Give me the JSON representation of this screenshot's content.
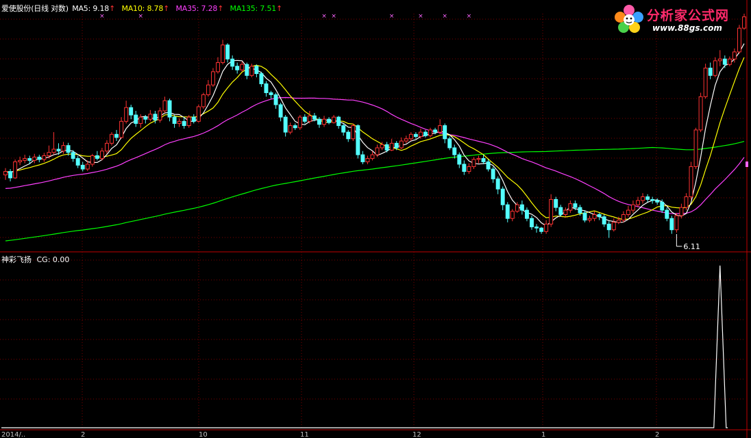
{
  "header": {
    "title": "爱使股份(日线 对数)",
    "ma5": "MA5: 9.18",
    "ma10": "MA10: 8.78",
    "ma35": "MA35: 7.28",
    "ma135": "MA135: 7.51",
    "up_arrow": "↑",
    "ma5_color": "#ffffff",
    "ma10_color": "#ffff00",
    "ma35_color": "#ff40ff",
    "ma135_color": "#00ff00"
  },
  "indicator": {
    "title": "神彩飞扬",
    "value": "CG: 0.00"
  },
  "logo": {
    "site_name": "分析家公式网",
    "url": "www.88gs.com"
  },
  "annotation": {
    "low_label": "6.11"
  },
  "x_axis_labels": [
    "2014/..",
    "2",
    "10",
    "11",
    "12",
    "1",
    "2"
  ],
  "colors": {
    "up": "#ff3333",
    "down": "#54ffff",
    "grid": "#800000",
    "axis": "#c00000"
  },
  "chart_data": [
    {
      "type": "candlestick",
      "title": "爱使股份(日线 对数)",
      "scale": "log",
      "ylim": [
        5.9,
        11.4
      ],
      "annotations": [
        {
          "index": 139,
          "text": "6.11"
        }
      ],
      "candles": [
        [
          7.28,
          7.35,
          7.42,
          7.18
        ],
        [
          7.35,
          7.22,
          7.4,
          7.15
        ],
        [
          7.22,
          7.55,
          7.6,
          7.2
        ],
        [
          7.55,
          7.58,
          7.66,
          7.48
        ],
        [
          7.58,
          7.62,
          7.7,
          7.52
        ],
        [
          7.62,
          7.58,
          7.68,
          7.5
        ],
        [
          7.58,
          7.65,
          7.72,
          7.52
        ],
        [
          7.65,
          7.6,
          7.7,
          7.54
        ],
        [
          7.6,
          7.68,
          7.74,
          7.55
        ],
        [
          7.68,
          7.75,
          7.9,
          7.62
        ],
        [
          7.75,
          7.82,
          8.2,
          7.7
        ],
        [
          7.82,
          7.78,
          7.95,
          7.7
        ],
        [
          7.78,
          7.9,
          7.98,
          7.72
        ],
        [
          7.9,
          7.75,
          7.96,
          7.68
        ],
        [
          7.75,
          7.62,
          7.8,
          7.55
        ],
        [
          7.62,
          7.48,
          7.68,
          7.42
        ],
        [
          7.48,
          7.4,
          7.55,
          7.35
        ],
        [
          7.4,
          7.5,
          7.58,
          7.36
        ],
        [
          7.5,
          7.68,
          7.72,
          7.45
        ],
        [
          7.68,
          7.62,
          7.78,
          7.58
        ],
        [
          7.62,
          7.78,
          7.85,
          7.58
        ],
        [
          7.78,
          7.95,
          8.02,
          7.72
        ],
        [
          7.95,
          8.15,
          8.2,
          7.9
        ],
        [
          8.15,
          8.08,
          8.25,
          8.0
        ],
        [
          8.08,
          8.45,
          8.55,
          8.05
        ],
        [
          8.45,
          8.78,
          8.95,
          8.4
        ],
        [
          8.78,
          8.6,
          8.85,
          8.5
        ],
        [
          8.6,
          8.4,
          8.7,
          8.32
        ],
        [
          8.4,
          8.55,
          8.62,
          8.3
        ],
        [
          8.55,
          8.5,
          8.6,
          8.4
        ],
        [
          8.5,
          8.62,
          8.72,
          8.45
        ],
        [
          8.62,
          8.48,
          8.7,
          8.4
        ],
        [
          8.48,
          8.7,
          8.78,
          8.42
        ],
        [
          8.7,
          8.95,
          9.05,
          8.65
        ],
        [
          8.95,
          8.55,
          9.0,
          8.45
        ],
        [
          8.55,
          8.4,
          8.6,
          8.3
        ],
        [
          8.4,
          8.45,
          8.52,
          8.32
        ],
        [
          8.45,
          8.35,
          8.55,
          8.28
        ],
        [
          8.35,
          8.55,
          8.6,
          8.3
        ],
        [
          8.55,
          8.45,
          8.62,
          8.4
        ],
        [
          8.45,
          8.8,
          8.85,
          8.42
        ],
        [
          8.8,
          9.1,
          9.15,
          8.75
        ],
        [
          9.1,
          9.35,
          9.48,
          9.05
        ],
        [
          9.35,
          9.7,
          9.8,
          9.3
        ],
        [
          9.7,
          9.95,
          10.1,
          9.65
        ],
        [
          9.95,
          10.45,
          10.6,
          9.9
        ],
        [
          10.45,
          10.05,
          10.5,
          9.95
        ],
        [
          10.05,
          9.85,
          10.15,
          9.75
        ],
        [
          9.85,
          9.75,
          9.95,
          9.65
        ],
        [
          9.75,
          9.9,
          9.98,
          9.7
        ],
        [
          9.9,
          9.6,
          9.95,
          9.5
        ],
        [
          9.6,
          9.85,
          9.92,
          9.55
        ],
        [
          9.85,
          9.65,
          9.9,
          9.55
        ],
        [
          9.65,
          9.38,
          9.7,
          9.3
        ],
        [
          9.38,
          9.15,
          9.45,
          9.05
        ],
        [
          9.15,
          9.1,
          9.2,
          9.0
        ],
        [
          9.1,
          8.85,
          9.15,
          8.75
        ],
        [
          8.85,
          8.55,
          8.9,
          8.45
        ],
        [
          8.55,
          8.2,
          8.6,
          8.1
        ],
        [
          8.2,
          8.35,
          8.42,
          8.15
        ],
        [
          8.35,
          8.3,
          8.4,
          8.25
        ],
        [
          8.3,
          8.55,
          8.6,
          8.25
        ],
        [
          8.55,
          8.45,
          8.62,
          8.4
        ],
        [
          8.45,
          8.58,
          8.7,
          8.4
        ],
        [
          8.58,
          8.5,
          8.65,
          8.45
        ],
        [
          8.5,
          8.38,
          8.55,
          8.3
        ],
        [
          8.38,
          8.5,
          8.58,
          8.32
        ],
        [
          8.5,
          8.42,
          8.55,
          8.38
        ],
        [
          8.42,
          8.55,
          8.6,
          8.4
        ],
        [
          8.55,
          8.35,
          8.58,
          8.28
        ],
        [
          8.35,
          8.2,
          8.4,
          8.12
        ],
        [
          8.2,
          8.05,
          8.25,
          7.98
        ],
        [
          8.05,
          8.35,
          8.4,
          8.0
        ],
        [
          8.35,
          7.7,
          8.38,
          7.62
        ],
        [
          7.7,
          7.55,
          7.78,
          7.5
        ],
        [
          7.55,
          7.62,
          7.68,
          7.5
        ],
        [
          7.62,
          7.7,
          7.78,
          7.58
        ],
        [
          7.7,
          7.85,
          7.92,
          7.65
        ],
        [
          7.85,
          7.92,
          7.98,
          7.8
        ],
        [
          7.92,
          7.8,
          7.98,
          7.75
        ],
        [
          7.8,
          7.95,
          8.05,
          7.78
        ],
        [
          7.95,
          7.85,
          8.0,
          7.8
        ],
        [
          7.85,
          8.0,
          8.08,
          7.82
        ],
        [
          8.0,
          8.05,
          8.12,
          7.95
        ],
        [
          8.05,
          8.15,
          8.2,
          8.0
        ],
        [
          8.15,
          8.1,
          8.2,
          8.05
        ],
        [
          8.1,
          8.2,
          8.28,
          8.05
        ],
        [
          8.2,
          8.12,
          8.25,
          8.08
        ],
        [
          8.12,
          8.25,
          8.3,
          8.08
        ],
        [
          8.25,
          8.2,
          8.3,
          8.15
        ],
        [
          8.2,
          8.35,
          8.5,
          8.15
        ],
        [
          8.35,
          8.05,
          8.4,
          7.95
        ],
        [
          8.05,
          7.85,
          8.1,
          7.8
        ],
        [
          7.85,
          7.7,
          7.92,
          7.62
        ],
        [
          7.7,
          7.5,
          7.75,
          7.42
        ],
        [
          7.5,
          7.35,
          7.58,
          7.28
        ],
        [
          7.35,
          7.45,
          7.52,
          7.3
        ],
        [
          7.45,
          7.6,
          7.65,
          7.4
        ],
        [
          7.6,
          7.62,
          7.68,
          7.52
        ],
        [
          7.62,
          7.55,
          7.7,
          7.5
        ],
        [
          7.55,
          7.4,
          7.6,
          7.35
        ],
        [
          7.4,
          7.2,
          7.45,
          7.12
        ],
        [
          7.2,
          7.0,
          7.25,
          6.9
        ],
        [
          7.0,
          6.7,
          7.05,
          6.6
        ],
        [
          6.7,
          6.45,
          6.75,
          6.38
        ],
        [
          6.45,
          6.58,
          6.62,
          6.4
        ],
        [
          6.58,
          6.7,
          6.75,
          6.55
        ],
        [
          6.7,
          6.6,
          6.78,
          6.52
        ],
        [
          6.6,
          6.45,
          6.65,
          6.4
        ],
        [
          6.45,
          6.3,
          6.5,
          6.25
        ],
        [
          6.3,
          6.28,
          6.35,
          6.2
        ],
        [
          6.28,
          6.22,
          6.3,
          6.18
        ],
        [
          6.22,
          6.35,
          6.42,
          6.18
        ],
        [
          6.35,
          6.8,
          6.9,
          6.3
        ],
        [
          6.8,
          6.65,
          6.85,
          6.58
        ],
        [
          6.65,
          6.52,
          6.7,
          6.48
        ],
        [
          6.52,
          6.6,
          6.65,
          6.48
        ],
        [
          6.6,
          6.72,
          6.78,
          6.55
        ],
        [
          6.72,
          6.65,
          6.78,
          6.6
        ],
        [
          6.65,
          6.55,
          6.7,
          6.5
        ],
        [
          6.55,
          6.42,
          6.6,
          6.38
        ],
        [
          6.42,
          6.45,
          6.5,
          6.38
        ],
        [
          6.45,
          6.52,
          6.58,
          6.4
        ],
        [
          6.52,
          6.48,
          6.55,
          6.42
        ],
        [
          6.48,
          6.35,
          6.52,
          6.3
        ],
        [
          6.35,
          6.25,
          6.4,
          6.11
        ],
        [
          6.25,
          6.38,
          6.45,
          6.22
        ],
        [
          6.38,
          6.42,
          6.48,
          6.35
        ],
        [
          6.42,
          6.52,
          6.58,
          6.38
        ],
        [
          6.52,
          6.6,
          6.68,
          6.48
        ],
        [
          6.6,
          6.7,
          6.78,
          6.55
        ],
        [
          6.7,
          6.78,
          6.85,
          6.65
        ],
        [
          6.78,
          6.85,
          6.92,
          6.72
        ],
        [
          6.85,
          6.8,
          6.9,
          6.75
        ],
        [
          6.8,
          6.78,
          6.85,
          6.72
        ],
        [
          6.78,
          6.75,
          6.82,
          6.7
        ],
        [
          6.75,
          6.6,
          6.8,
          6.55
        ],
        [
          6.6,
          6.45,
          6.65,
          6.4
        ],
        [
          6.45,
          6.25,
          6.5,
          6.18
        ],
        [
          6.25,
          6.5,
          6.55,
          6.2
        ],
        [
          6.5,
          6.65,
          6.72,
          6.45
        ],
        [
          6.65,
          6.85,
          6.92,
          6.6
        ],
        [
          6.85,
          7.45,
          7.55,
          6.8
        ],
        [
          7.45,
          8.25,
          8.3,
          7.4
        ],
        [
          8.25,
          9.05,
          9.15,
          8.2
        ],
        [
          9.05,
          9.8,
          9.92,
          9.0
        ],
        [
          9.8,
          9.6,
          9.95,
          9.5
        ],
        [
          9.6,
          10.0,
          10.1,
          9.55
        ],
        [
          10.0,
          10.05,
          10.3,
          9.85
        ],
        [
          10.05,
          9.9,
          10.15,
          9.8
        ],
        [
          9.9,
          10.05,
          10.12,
          9.85
        ],
        [
          10.05,
          10.25,
          10.35,
          9.95
        ],
        [
          10.25,
          10.95,
          11.05,
          10.2
        ],
        [
          10.95,
          11.3,
          11.4,
          10.9
        ]
      ],
      "moving_averages": [
        {
          "name": "MA5",
          "period": 5,
          "value": "9.18",
          "color": "#ffffff"
        },
        {
          "name": "MA10",
          "period": 10,
          "value": "8.78",
          "color": "#ffff00"
        },
        {
          "name": "MA35",
          "period": 35,
          "value": "7.28",
          "color": "#ff40ff"
        },
        {
          "name": "MA135",
          "period": 135,
          "value": "7.51",
          "color": "#00ff00"
        }
      ],
      "ma35_prefix": [
        7.0,
        7.02,
        7.05
      ],
      "ma135_start": 6.05
    },
    {
      "type": "line",
      "title": "神彩飞扬",
      "series": [
        {
          "name": "CG",
          "value_label": "0.00",
          "spike_index": 148,
          "spike_value": 1.0,
          "baseline": 0
        }
      ]
    }
  ]
}
